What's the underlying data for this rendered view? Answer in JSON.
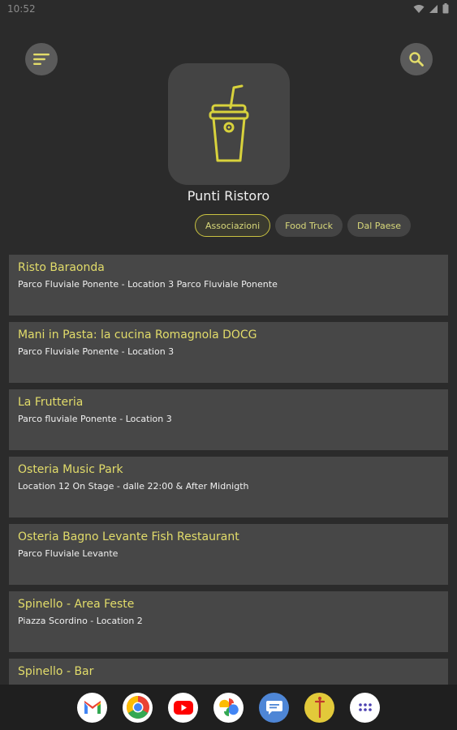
{
  "status_bar": {
    "time": "10:52"
  },
  "header": {
    "title": "Punti Ristoro"
  },
  "filters": [
    {
      "label": "Associazioni",
      "selected": true
    },
    {
      "label": "Food Truck",
      "selected": false
    },
    {
      "label": "Dal Paese",
      "selected": false
    }
  ],
  "items": [
    {
      "title": "Risto Baraonda",
      "subtitle": "Parco Fluviale Ponente - Location 3 Parco Fluviale Ponente"
    },
    {
      "title": "Mani in Pasta: la cucina Romagnola DOCG",
      "subtitle": "Parco Fluviale Ponente - Location 3"
    },
    {
      "title": "La Frutteria",
      "subtitle": "Parco fluviale Ponente - Location 3"
    },
    {
      "title": "Osteria Music Park",
      "subtitle": "Location 12 On Stage - dalle 22:00 & After Midnigth"
    },
    {
      "title": "Osteria Bagno Levante Fish Restaurant",
      "subtitle": "Parco Fluviale Levante"
    },
    {
      "title": "Spinello - Area Feste",
      "subtitle": "Piazza Scordino - Location 2"
    },
    {
      "title": "Spinello - Bar",
      "subtitle": ""
    }
  ],
  "colors": {
    "accent": "#e2dc6a",
    "background": "#2b2b2b",
    "card": "#474747"
  },
  "dock": {
    "icons": [
      "gmail-icon",
      "chrome-icon",
      "youtube-icon",
      "photos-icon",
      "messages-icon",
      "event-app-icon",
      "app-drawer-icon"
    ]
  }
}
